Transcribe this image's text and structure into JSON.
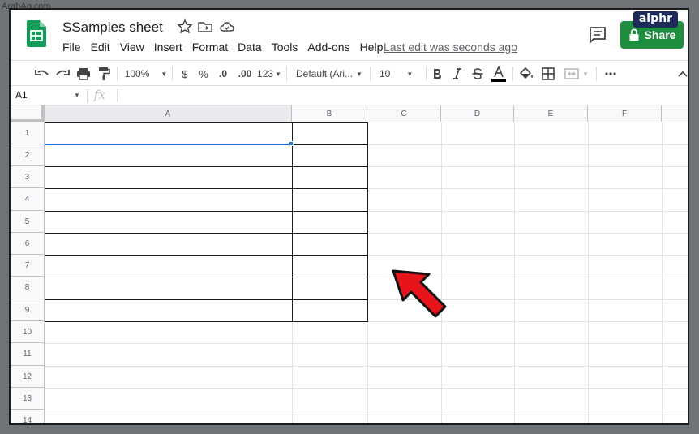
{
  "watermark_left": "ArabAq.com",
  "watermark_badge": "alphr",
  "doc": {
    "title": "SSamples sheet"
  },
  "menu": [
    "File",
    "Edit",
    "View",
    "Insert",
    "Format",
    "Data",
    "Tools",
    "Add-ons",
    "Help"
  ],
  "last_edit": "Last edit was seconds ago",
  "share_label": "Share",
  "toolbar": {
    "zoom": "100%",
    "currency": "$",
    "percent": "%",
    "decrease_decimal": ".0",
    "increase_decimal": ".00",
    "more_formats": "123",
    "font": "Default (Ari...",
    "font_size": "10"
  },
  "formula_bar": {
    "name_box": "A1",
    "fx": "fx"
  },
  "columns": [
    "A",
    "B",
    "C",
    "D",
    "E",
    "F"
  ],
  "rows": [
    "1",
    "2",
    "3",
    "4",
    "5",
    "6",
    "7",
    "8",
    "9",
    "10",
    "11",
    "12",
    "13",
    "14"
  ],
  "colors": {
    "share_green": "#1e8e3e",
    "selection_blue": "#1a73e8",
    "arrow_red": "#e8141b"
  }
}
